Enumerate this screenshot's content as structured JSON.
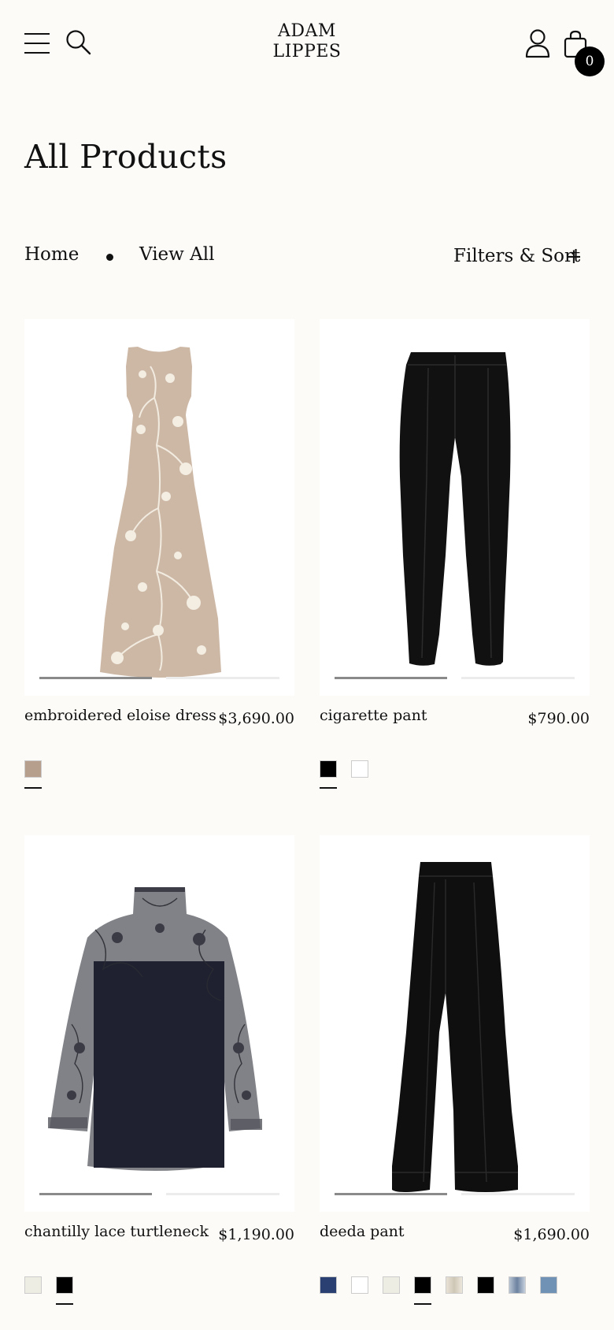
{
  "header": {
    "logo_line1": "ADAM",
    "logo_line2": "LIPPES",
    "bag_count": "0",
    "icons": [
      "menu-icon",
      "search-icon",
      "account-icon",
      "shopping-bag-icon"
    ]
  },
  "page": {
    "title": "All Products"
  },
  "breadcrumb": {
    "home": "Home",
    "current": "View All"
  },
  "filters": {
    "label": "Filters & Sort",
    "plus": "+"
  },
  "products": [
    {
      "name": "embroidered eloise dress",
      "price": "$3,690.00",
      "image_slides_total": 2,
      "image_slide_active": 1,
      "swatches": [
        {
          "color": "#b6a08d",
          "selected": true
        }
      ]
    },
    {
      "name": "cigarette pant",
      "price": "$790.00",
      "image_slides_total": 2,
      "image_slide_active": 1,
      "swatches": [
        {
          "color": "#000000",
          "selected": true
        },
        {
          "color": "#ffffff",
          "selected": false
        }
      ]
    },
    {
      "name": "chantilly lace turtleneck",
      "price": "$1,190.00",
      "image_slides_total": 2,
      "image_slide_active": 1,
      "swatches": [
        {
          "color": "#eeede4",
          "selected": false
        },
        {
          "color": "#000000",
          "selected": true
        }
      ]
    },
    {
      "name": "deeda pant",
      "price": "$1,690.00",
      "image_slides_total": 2,
      "image_slide_active": 1,
      "swatches": [
        {
          "color": "#2a3f72",
          "selected": false
        },
        {
          "color": "#ffffff",
          "selected": false
        },
        {
          "color": "#eeede4",
          "selected": false
        },
        {
          "color": "#000000",
          "selected": true
        },
        {
          "color": "#d8d2c6",
          "selected": false
        },
        {
          "color": "#000000",
          "selected": false
        },
        {
          "color": "#8ea2b8",
          "selected": false
        },
        {
          "color": "#6f92b5",
          "selected": false
        }
      ]
    }
  ]
}
